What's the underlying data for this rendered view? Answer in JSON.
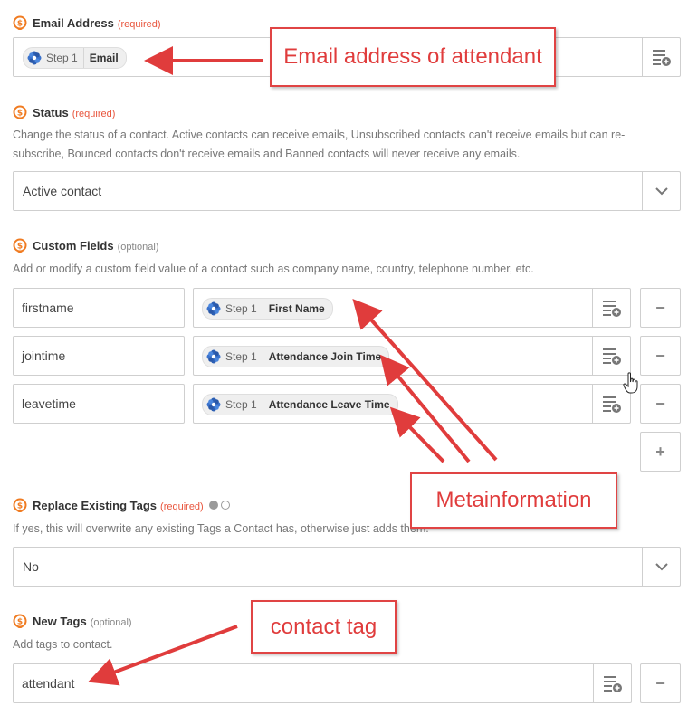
{
  "email": {
    "label": "Email Address",
    "required": "(required)",
    "pill": {
      "step": "Step 1",
      "value": "Email"
    }
  },
  "status": {
    "label": "Status",
    "required": "(required)",
    "help_line1": "Change the status of a contact. Active contacts can receive emails, Unsubscribed contacts can't receive emails but can re-",
    "help_line2": "subscribe, Bounced contacts don't receive emails and Banned contacts will never receive any emails.",
    "value": "Active contact"
  },
  "custom_fields": {
    "label": "Custom Fields",
    "optional": "(optional)",
    "help": "Add or modify a custom field value of a contact such as company name, country, telephone number, etc.",
    "rows": [
      {
        "key": "firstname",
        "step": "Step 1",
        "value": "First Name"
      },
      {
        "key": "jointime",
        "step": "Step 1",
        "value": "Attendance Join Time"
      },
      {
        "key": "leavetime",
        "step": "Step 1",
        "value": "Attendance Leave Time"
      }
    ],
    "remove_glyph": "−",
    "add_glyph": "+"
  },
  "replace_tags": {
    "label": "Replace Existing Tags",
    "required": "(required)",
    "help": "If yes, this will overwrite any existing Tags a Contact has, otherwise just adds them.",
    "value": "No"
  },
  "new_tags": {
    "label": "New Tags",
    "optional": "(optional)",
    "help": "Add tags to contact.",
    "value": "attendant",
    "remove_glyph": "−"
  },
  "annotations": {
    "email_note": "Email address of attendant",
    "meta_note": "Metainformation",
    "tag_note": "contact tag"
  },
  "colors": {
    "accent": "#f07b21",
    "required": "#e8553d",
    "annotation": "#e03c3c",
    "border": "#cfcfcf"
  },
  "icons": {
    "field": "dollar-circle-icon",
    "step_app": "gear-flower-icon",
    "insert_data": "list-plus-icon",
    "dropdown": "chevron-down-icon",
    "cursor": "hand-pointer-icon"
  }
}
